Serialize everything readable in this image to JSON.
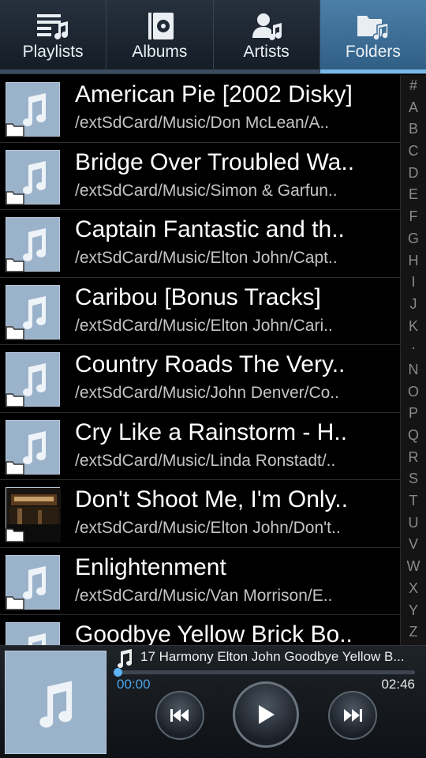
{
  "tabs": [
    {
      "label": "Playlists",
      "icon": "playlist-icon",
      "active": false
    },
    {
      "label": "Albums",
      "icon": "album-icon",
      "active": false
    },
    {
      "label": "Artists",
      "icon": "artist-icon",
      "active": false
    },
    {
      "label": "Folders",
      "icon": "folder-music-icon",
      "active": true
    }
  ],
  "folders": [
    {
      "title": "American Pie [2002 Disky]",
      "path": "/extSdCard/Music/Don McLean/A..",
      "art": "default"
    },
    {
      "title": "Bridge Over Troubled Wa..",
      "path": "/extSdCard/Music/Simon & Garfun..",
      "art": "default"
    },
    {
      "title": "Captain Fantastic and th..",
      "path": "/extSdCard/Music/Elton John/Capt..",
      "art": "default"
    },
    {
      "title": "Caribou [Bonus Tracks]",
      "path": "/extSdCard/Music/Elton John/Cari..",
      "art": "default"
    },
    {
      "title": "Country Roads  The Very..",
      "path": "/extSdCard/Music/John Denver/Co..",
      "art": "default"
    },
    {
      "title": "Cry Like a Rainstorm - H..",
      "path": "/extSdCard/Music/Linda Ronstadt/..",
      "art": "default"
    },
    {
      "title": "Don't Shoot Me, I'm Only..",
      "path": "/extSdCard/Music/Elton John/Don't..",
      "art": "photo"
    },
    {
      "title": "Enlightenment",
      "path": "/extSdCard/Music/Van Morrison/E..",
      "art": "default"
    },
    {
      "title": "Goodbye Yellow Brick Bo..",
      "path": "",
      "art": "default"
    }
  ],
  "index_letters": [
    "#",
    "A",
    "B",
    "C",
    "D",
    "E",
    "F",
    "G",
    "H",
    "I",
    "J",
    "K",
    "·",
    "N",
    "O",
    "P",
    "Q",
    "R",
    "S",
    "T",
    "U",
    "V",
    "W",
    "X",
    "Y",
    "Z"
  ],
  "player": {
    "now_playing": "17 Harmony Elton John Goodbye Yellow B...",
    "current_time": "00:00",
    "total_time": "02:46",
    "progress": 0.0
  },
  "colors": {
    "accent": "#4aa3e8",
    "active_tab": "#3f6f98",
    "thumb_bg": "#9bb2cb"
  }
}
